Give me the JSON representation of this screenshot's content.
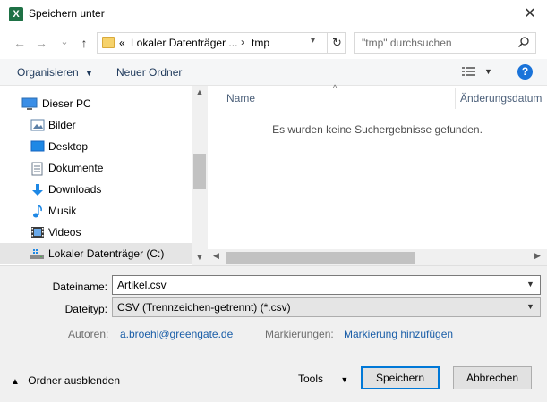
{
  "window": {
    "title": "Speichern unter",
    "app_icon_letter": "X",
    "close_glyph": "✕"
  },
  "nav": {
    "back_glyph": "←",
    "forward_glyph": "→",
    "recent_glyph": "⌄",
    "up_glyph": "↑"
  },
  "address": {
    "overflow": "«",
    "segments": [
      "Lokaler Datenträger ...",
      "tmp"
    ],
    "separator": "›",
    "refresh_glyph": "↻"
  },
  "search": {
    "placeholder": "\"tmp\" durchsuchen",
    "icon": "search-icon"
  },
  "commandbar": {
    "organize_label": "Organisieren",
    "new_folder_label": "Neuer Ordner",
    "help_label": "?"
  },
  "sidebar": {
    "items": [
      {
        "label": "Dieser PC",
        "icon": "pc-icon"
      },
      {
        "label": "Bilder",
        "icon": "pictures-icon"
      },
      {
        "label": "Desktop",
        "icon": "desktop-icon"
      },
      {
        "label": "Dokumente",
        "icon": "documents-icon"
      },
      {
        "label": "Downloads",
        "icon": "downloads-icon"
      },
      {
        "label": "Musik",
        "icon": "music-icon"
      },
      {
        "label": "Videos",
        "icon": "videos-icon"
      },
      {
        "label": "Lokaler Datenträger (C:)",
        "icon": "drive-icon",
        "selected": true
      }
    ]
  },
  "filelist": {
    "columns": [
      "Name",
      "Änderungsdatum"
    ],
    "empty_message": "Es wurden keine Suchergebnisse gefunden."
  },
  "form": {
    "filename_label": "Dateiname:",
    "filename_value": "Artikel.csv",
    "filetype_label": "Dateityp:",
    "filetype_value": "CSV (Trennzeichen-getrennt) (*.csv)",
    "authors_label": "Autoren:",
    "authors_value": "a.broehl@greengate.de",
    "tags_label": "Markierungen:",
    "tags_value": "Markierung hinzufügen"
  },
  "footer": {
    "hide_folders_label": "Ordner ausblenden",
    "tools_label": "Tools",
    "save_label": "Speichern",
    "cancel_label": "Abbrechen"
  },
  "colors": {
    "accent": "#0078d7",
    "link": "#1a5ea8",
    "selected_row": "#e5e5e5"
  }
}
